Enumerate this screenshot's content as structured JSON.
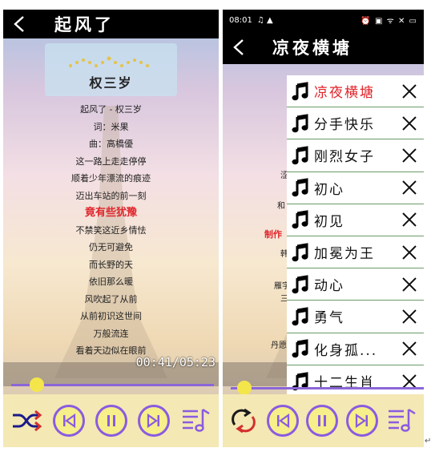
{
  "left": {
    "title": "起风了",
    "singer": "权三岁",
    "lyrics": [
      {
        "text": "起风了 - 权三岁",
        "highlight": false
      },
      {
        "text": "词：米果",
        "highlight": false
      },
      {
        "text": "曲：高橋優",
        "highlight": false
      },
      {
        "text": "这一路上走走停停",
        "highlight": false
      },
      {
        "text": "顺着少年漂流的痕迹",
        "highlight": false
      },
      {
        "text": "迈出车站的前一刻",
        "highlight": false
      },
      {
        "text": "竟有些犹豫",
        "highlight": true
      },
      {
        "text": "不禁笑这近乡情怯",
        "highlight": false
      },
      {
        "text": "仍无可避免",
        "highlight": false
      },
      {
        "text": "而长野的天",
        "highlight": false
      },
      {
        "text": "依旧那么暖",
        "highlight": false
      },
      {
        "text": "风吹起了从前",
        "highlight": false
      },
      {
        "text": "从前初识这世间",
        "highlight": false
      },
      {
        "text": "万般流连",
        "highlight": false
      },
      {
        "text": "看着天边似在眼前",
        "highlight": false
      }
    ],
    "time": "00:41/05:23",
    "progress": 0.12,
    "controls": {
      "mode_icon": "shuffle-icon",
      "prev_icon": "skip-previous-icon",
      "play_icon": "pause-icon",
      "next_icon": "skip-next-icon",
      "list_icon": "playlist-icon"
    }
  },
  "right": {
    "status": {
      "time": "08:01",
      "right": "⏰ ▣ ᯤ ✕ ▭"
    },
    "title": "凉夜横塘",
    "progress": 0.06,
    "side_fragments": [
      "涩",
      "和",
      "制作",
      "韩",
      "雁字",
      "三",
      "丹愿"
    ],
    "playlist": [
      {
        "name": "凉夜横塘",
        "active": true
      },
      {
        "name": "分手快乐",
        "active": false
      },
      {
        "name": "刚烈女子",
        "active": false
      },
      {
        "name": "初心",
        "active": false
      },
      {
        "name": "初见",
        "active": false
      },
      {
        "name": "加冕为王",
        "active": false
      },
      {
        "name": "动心",
        "active": false
      },
      {
        "name": "勇气",
        "active": false
      },
      {
        "name": "化身孤...",
        "active": false
      },
      {
        "name": "十二生肖",
        "active": false
      }
    ],
    "controls": {
      "mode_icon": "repeat-icon",
      "prev_icon": "skip-previous-icon",
      "play_icon": "pause-icon",
      "next_icon": "skip-next-icon",
      "list_icon": "playlist-icon"
    }
  },
  "colors": {
    "accent": "#8a5be0",
    "knob": "#f4e64a",
    "highlight": "#e1242a",
    "control_bg": "#f4e8b4"
  },
  "corner_mark": "↵"
}
